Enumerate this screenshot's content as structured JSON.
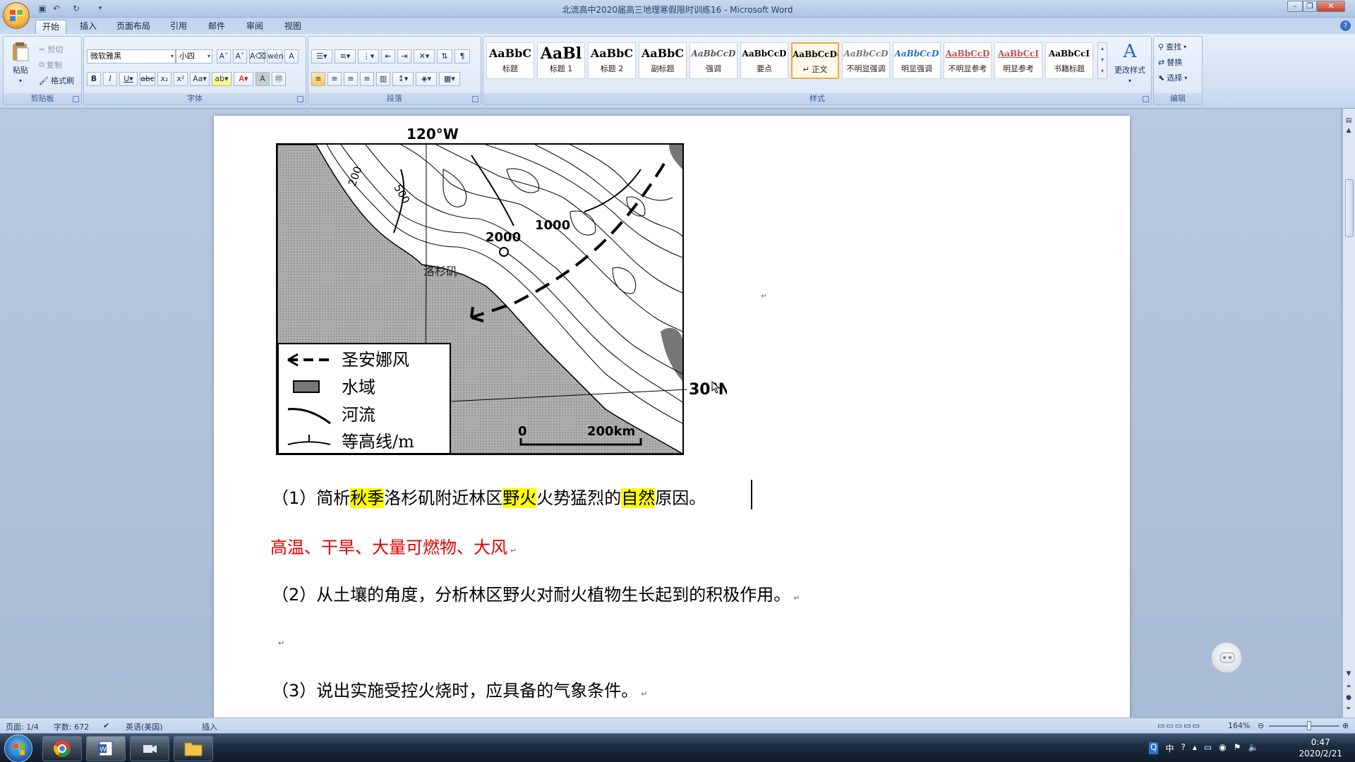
{
  "window": {
    "title": "北流高中2020届高三地理寒假限时训练16 - Microsoft Word"
  },
  "tabs": [
    "开始",
    "插入",
    "页面布局",
    "引用",
    "邮件",
    "审阅",
    "视图"
  ],
  "clipboard": {
    "paste": "粘贴",
    "cut": "剪切",
    "copy": "复制",
    "format_painter": "格式刷",
    "label": "剪贴板"
  },
  "font": {
    "name": "微软雅黑",
    "size": "小四",
    "label": "字体"
  },
  "paragraph": {
    "label": "段落"
  },
  "styles": {
    "items": [
      {
        "preview": "AaBbC",
        "name": "标题"
      },
      {
        "preview": "AaBl",
        "name": "标题 1"
      },
      {
        "preview": "AaBbC",
        "name": "标题 2"
      },
      {
        "preview": "AaBbC",
        "name": "副标题"
      },
      {
        "preview": "AaBbCcD",
        "name": "强调"
      },
      {
        "preview": "AaBbCcD",
        "name": "要点"
      },
      {
        "preview": "AaBbCcDc",
        "name": "↵ 正文"
      },
      {
        "preview": "AaBbCcD",
        "name": "不明显强调"
      },
      {
        "preview": "AaBbCcD",
        "name": "明显强调"
      },
      {
        "preview": "AaBbCcD",
        "name": "不明显参考"
      },
      {
        "preview": "AaBbCcI",
        "name": "明显参考"
      },
      {
        "preview": "AaBbCcI",
        "name": "书籍标题"
      }
    ],
    "change": "更改样式",
    "label": "样式"
  },
  "editing": {
    "find": "查找",
    "replace": "替换",
    "select": "选择",
    "label": "编辑"
  },
  "map": {
    "lon": "120°W",
    "lat": "30°N",
    "city": "洛杉矶",
    "c500": "500",
    "c200": "200",
    "c2000": "2000",
    "c1000": "1000",
    "legend": [
      "圣安娜风",
      "水域",
      "河流",
      "等高线/m"
    ],
    "scale0": "0",
    "scale": "200km"
  },
  "doc": {
    "q1": {
      "a": "（1）简析",
      "h1": "秋季",
      "b": "洛杉矶附近林区",
      "h2": "野火",
      "c": "火势猛烈的",
      "h3": "自然",
      "d": "原因。"
    },
    "answer": "高温、干旱、大量可燃物、大风",
    "q2": "（2）从土壤的角度，分析林区野火对耐火植物生长起到的积极作用。",
    "q3": "（3）说出实施受控火烧时，应具备的气象条件。",
    "pmark": "↵"
  },
  "status": {
    "page": "页面: 1/4",
    "words": "字数: 672",
    "lang": "英语(美国)",
    "mode": "插入",
    "zoom": "164%"
  },
  "taskbar": {
    "time": "0:47",
    "date": "2020/2/21",
    "ime": "中"
  }
}
